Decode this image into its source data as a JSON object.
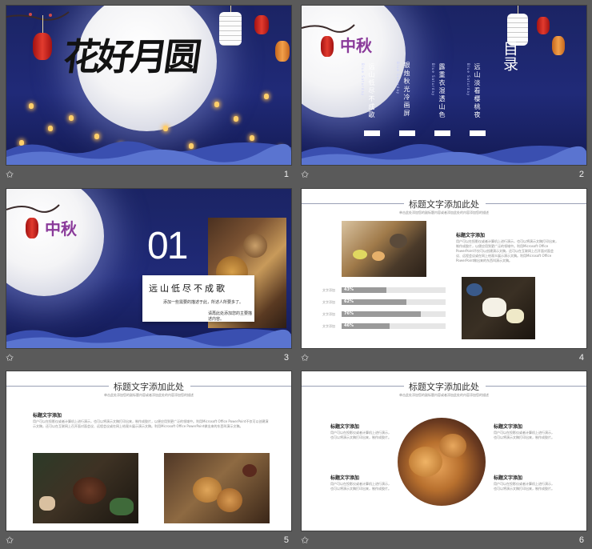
{
  "slides": [
    {
      "number": "1",
      "title_calligraphy": "花好月圆"
    },
    {
      "number": "2",
      "logo": "中秋",
      "toc_title": "目录",
      "toc_items": [
        {
          "title": "远山低尽不成歌",
          "sub": "Blue Saturday"
        },
        {
          "title": "银烛秋光冷画屏",
          "sub": "Blue Saturday"
        },
        {
          "title": "露重衣湿透山色",
          "sub": "Blue Saturday"
        },
        {
          "title": "远山淡看樱桃夜",
          "sub": "Blue Saturday"
        }
      ]
    },
    {
      "number": "3",
      "logo": "中秋",
      "section_number": "01",
      "section_title": "远山低尽不成歌",
      "section_text_1": "添加一些需要的描述于此，所述人所要多了。",
      "section_text_2": "请再此处添加您的主要描述内容。"
    },
    {
      "number": "4",
      "header": "标题文字添加此处",
      "header_sub": "单击此处添加您的副标题内容或者添加此处的内容添加您的描述",
      "block_title": "标题文字添加",
      "block_text": "用户可以在投影仪或者计算机上进行演示，也可以将演示文稿打印出来，制作成胶片，以便应用到更广泛的领域中。利用Microsoft Office PowerPoint不仅可以创建演示文稿，还可以在互联网上召开面对面会议、远程会议或在网上给观众展示演示文稿。利用Microsoft Office PowerPoint做出来的东西叫演示文稿。",
      "bars": [
        {
          "label": "文字添加",
          "pct": "43%",
          "value": 43
        },
        {
          "label": "文字添加",
          "pct": "62%",
          "value": 62
        },
        {
          "label": "文字添加",
          "pct": "76%",
          "value": 76
        },
        {
          "label": "文字添加",
          "pct": "46%",
          "value": 46
        }
      ]
    },
    {
      "number": "5",
      "header": "标题文字添加此处",
      "header_sub": "单击此处添加您的副标题内容或者添加此处的内容添加您的描述",
      "block_title": "标题文字添加",
      "block_text": "用户可以在投影仪或者计算机上进行演示，也可以将演示文稿打印出来，制作成胶片，以便应用到更广泛的领域中。利用Microsoft Office PowerPoint不仅可以创建演示文稿，还可以在互联网上召开面对面会议、远程会议或在网上给观众展示演示文稿。利用Microsoft Office PowerPoint做出来的东西叫演示文稿。"
    },
    {
      "number": "6",
      "header": "标题文字添加此处",
      "header_sub": "单击此处添加您的副标题内容或者添加此处的内容添加您的描述",
      "blocks": [
        {
          "title": "标题文字添加",
          "text": "用户可以在投影仪或者计算机上进行演示，也可以将演示文稿打印出来，制作成胶片。"
        },
        {
          "title": "标题文字添加",
          "text": "用户可以在投影仪或者计算机上进行演示，也可以将演示文稿打印出来，制作成胶片。"
        },
        {
          "title": "标题文字添加",
          "text": "用户可以在投影仪或者计算机上进行演示，也可以将演示文稿打印出来，制作成胶片。"
        },
        {
          "title": "标题文字添加",
          "text": "用户可以在投影仪或者计算机上进行演示，也可以将演示文稿打印出来，制作成胶片。"
        }
      ]
    }
  ],
  "icons": {
    "slide_marker": "star-icon"
  },
  "colors": {
    "night_blue": "#1f2874",
    "accent_purple": "#8a3a9a",
    "lantern_red": "#d8312a",
    "bar_fill": "#9a9a9a"
  }
}
